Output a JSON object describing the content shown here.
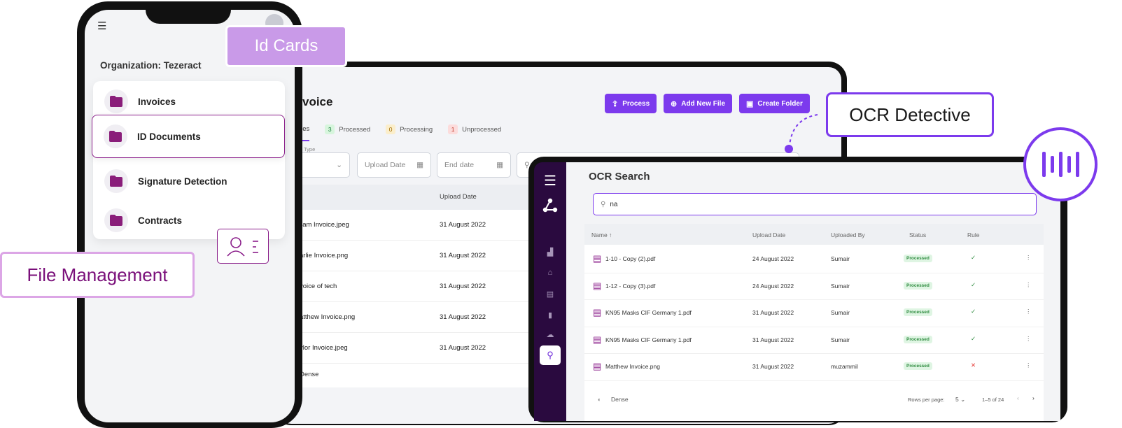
{
  "callouts": {
    "id_cards": "Id Cards",
    "file_management": "File Management",
    "ocr_detective": "OCR Detective"
  },
  "phone": {
    "organization": "Organization: Tezeract",
    "folders": [
      {
        "label": "Invoices"
      },
      {
        "label": "ID Documents",
        "selected": true
      },
      {
        "label": "Signature Detection"
      },
      {
        "label": "Contracts"
      }
    ]
  },
  "tablet": {
    "title": "voice",
    "buttons": {
      "process": "Process",
      "add_new_file": "Add New File",
      "create_folder": "Create Folder"
    },
    "tabs": [
      {
        "label": "iles",
        "count": ""
      },
      {
        "label": "Processed",
        "count": "3"
      },
      {
        "label": "Processing",
        "count": "0"
      },
      {
        "label": "Unprocessed",
        "count": "1"
      }
    ],
    "filters": {
      "type_caption": "Type",
      "upload_date": "Upload Date",
      "end_date": "End date"
    },
    "columns": {
      "name": "↑",
      "upload_date": "Upload Date"
    },
    "rows": [
      {
        "name": "liam Invoice.jpeg",
        "date": "31 August 2022"
      },
      {
        "name": "arlie Invoice.png",
        "date": "31 August 2022"
      },
      {
        "name": "voice of tech",
        "date": "31 August 2022"
      },
      {
        "name": "atthew Invoice.png",
        "date": "31 August 2022"
      },
      {
        "name": "ylor Invoice.jpeg",
        "date": "31 August 2022"
      }
    ],
    "dense": "Dense"
  },
  "ocr": {
    "title": "OCR Search",
    "search_value": "na",
    "columns": {
      "name": "Name ↑",
      "upload_date": "Upload Date",
      "uploaded_by": "Uploaded By",
      "status": "Status",
      "rule": "Rule"
    },
    "rows": [
      {
        "name": "1-10 - Copy (2).pdf",
        "date": "24 August 2022",
        "by": "Sumair",
        "status": "Processed",
        "rule": "✓",
        "rule_ok": true
      },
      {
        "name": "1-12 - Copy (3).pdf",
        "date": "24 August 2022",
        "by": "Sumair",
        "status": "Processed",
        "rule": "✓",
        "rule_ok": true
      },
      {
        "name": "KN95 Masks CIF Germany 1.pdf",
        "date": "31 August 2022",
        "by": "Sumair",
        "status": "Processed",
        "rule": "✓",
        "rule_ok": true
      },
      {
        "name": "KN95 Masks CIF Germany 1.pdf",
        "date": "31 August 2022",
        "by": "Sumair",
        "status": "Processed",
        "rule": "✓",
        "rule_ok": true
      },
      {
        "name": "Matthew Invoice.png",
        "date": "31 August 2022",
        "by": "muzammil",
        "status": "Processed",
        "rule": "✕",
        "rule_ok": false
      }
    ],
    "dense": "Dense",
    "rows_per_page_label": "Rows per page:",
    "rows_per_page": "5",
    "range": "1–5 of 24"
  },
  "colors": {
    "accent": "#7c3aed",
    "brand_magenta": "#8a1e8a",
    "sidebar": "#2a0a3f"
  }
}
